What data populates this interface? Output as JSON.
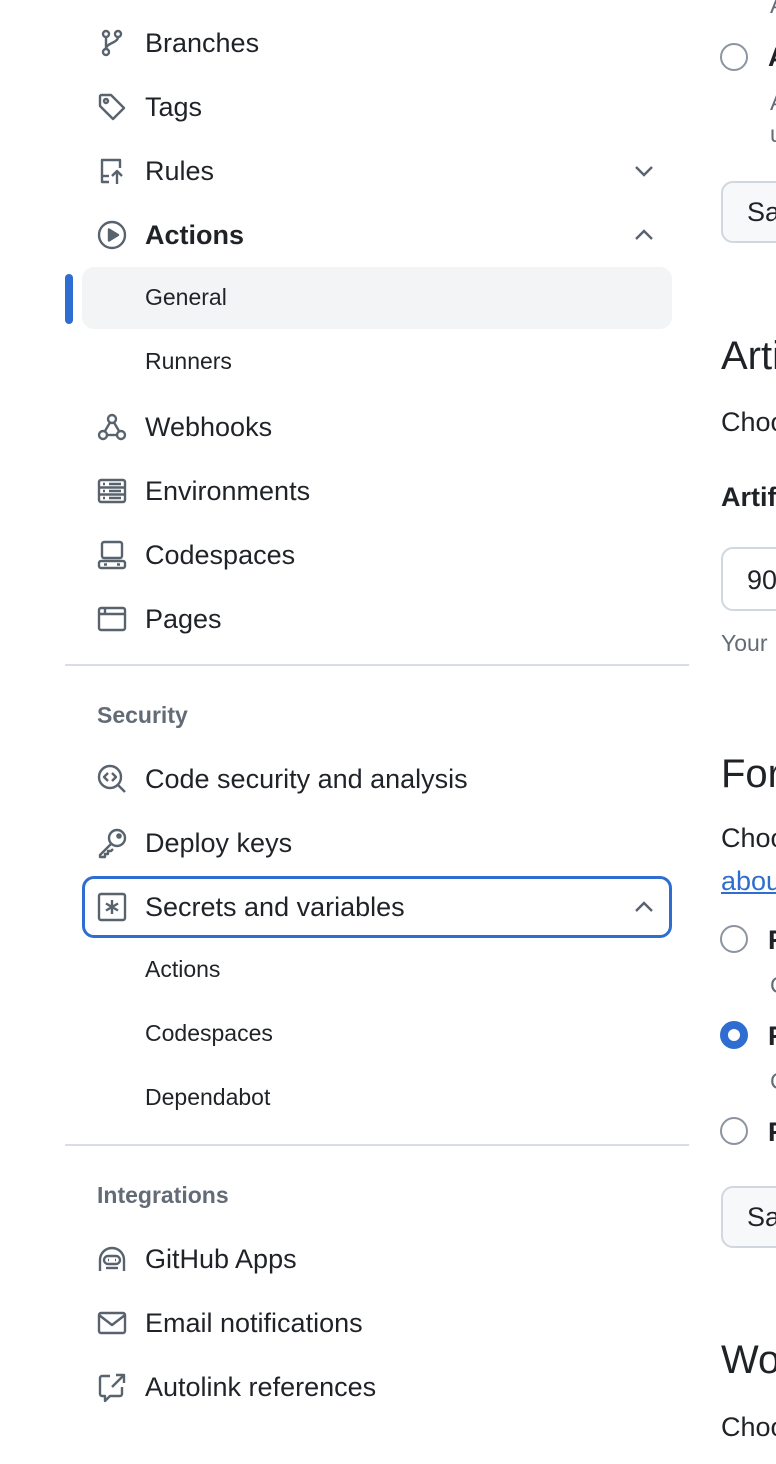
{
  "sidebar": {
    "code_items": [
      {
        "label": "Branches",
        "icon": "git-branch-icon"
      },
      {
        "label": "Tags",
        "icon": "tag-icon"
      },
      {
        "label": "Rules",
        "icon": "repo-push-icon"
      },
      {
        "label": "Actions",
        "icon": "play-icon"
      }
    ],
    "actions_sub": [
      {
        "label": "General"
      },
      {
        "label": "Runners"
      }
    ],
    "more_items": [
      {
        "label": "Webhooks",
        "icon": "webhook-icon"
      },
      {
        "label": "Environments",
        "icon": "server-icon"
      },
      {
        "label": "Codespaces",
        "icon": "codespaces-icon"
      },
      {
        "label": "Pages",
        "icon": "browser-icon"
      }
    ],
    "security_heading": "Security",
    "security_items": [
      {
        "label": "Code security and analysis",
        "icon": "codescan-icon"
      },
      {
        "label": "Deploy keys",
        "icon": "key-icon"
      },
      {
        "label": "Secrets and variables",
        "icon": "key-asterisk-icon"
      }
    ],
    "secrets_sub": [
      {
        "label": "Actions"
      },
      {
        "label": "Codespaces"
      },
      {
        "label": "Dependabot"
      }
    ],
    "integrations_heading": "Integrations",
    "integration_items": [
      {
        "label": "GitHub Apps",
        "icon": "hubot-icon"
      },
      {
        "label": "Email notifications",
        "icon": "mail-icon"
      },
      {
        "label": "Autolink references",
        "icon": "cross-reference-icon"
      }
    ]
  },
  "main": {
    "frag_a1": "A",
    "frag_a2": "A",
    "frag_a3": "A",
    "frag_u": "u",
    "save_btn_1": "Sa",
    "artifact_heading": "Arti",
    "artifact_desc": "Choo",
    "artifact_label": "Artif",
    "artifact_input": "90",
    "artifact_note": "Your",
    "fork_heading": "For",
    "fork_desc": "Choo",
    "fork_link": "abou",
    "fork_r1": "R",
    "fork_r1_desc": "C",
    "fork_r2": "R",
    "fork_r2_desc": "C",
    "fork_r3": "R",
    "save_btn_2": "Sa",
    "workflow_heading": "Wo",
    "workflow_desc": "Choo"
  },
  "colors": {
    "accent": "#2f6ed0",
    "active_bg": "#f3f4f6",
    "divider": "#d8dee4",
    "muted": "#636c76"
  }
}
